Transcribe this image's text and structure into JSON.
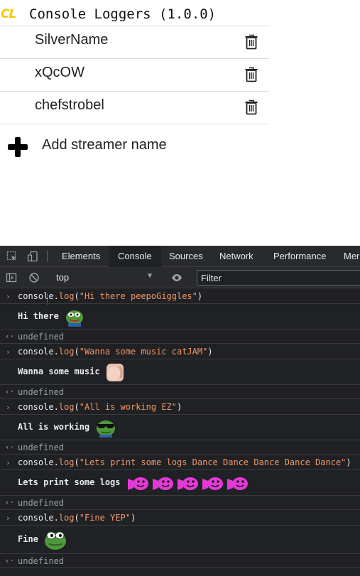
{
  "popup": {
    "logo": "CL",
    "title": "Console Loggers (1.0.0)",
    "streamers": [
      {
        "name": "SilverName"
      },
      {
        "name": "xQcOW"
      },
      {
        "name": "chefstrobel"
      }
    ],
    "add_label": "Add streamer name"
  },
  "devtools": {
    "tabs": [
      "Elements",
      "Console",
      "Sources",
      "Network",
      "Performance",
      "Mer"
    ],
    "active_tab": "Console",
    "context": "top",
    "filter_placeholder": "Filter",
    "entries": [
      {
        "cmd_prefix": "console.",
        "cmd_method": "log",
        "cmd_open": "(",
        "cmd_string": "\"Hi there peepoGiggles\"",
        "cmd_close": ")",
        "output": "Hi there",
        "result": "undefined",
        "emote": "peepoGiggles"
      },
      {
        "cmd_prefix": "console.",
        "cmd_method": "log",
        "cmd_open": "(",
        "cmd_string": "\"Wanna some music catJAM\"",
        "cmd_close": ")",
        "output": "Wanna some music",
        "result": "undefined",
        "emote": "catJAM"
      },
      {
        "cmd_prefix": "console.",
        "cmd_method": "log",
        "cmd_open": "(",
        "cmd_string": "\"All is working EZ\"",
        "cmd_close": ")",
        "output": "All is working",
        "result": "undefined",
        "emote": "EZ"
      },
      {
        "cmd_prefix": "console.",
        "cmd_method": "log",
        "cmd_open": "(",
        "cmd_string": "\"Lets print some logs Dance Dance Dance Dance Dance\"",
        "cmd_close": ")",
        "output": "Lets print some logs",
        "result": "undefined",
        "emote": "Dance"
      },
      {
        "cmd_prefix": "console.",
        "cmd_method": "log",
        "cmd_open": "(",
        "cmd_string": "\"Fine YEP\"",
        "cmd_close": ")",
        "output": "Fine",
        "result": "undefined",
        "emote": "YEP"
      }
    ]
  },
  "colors": {
    "logo": "#f7c800",
    "string": "#f29766",
    "console_bg": "#202124",
    "toolbar_bg": "#292a2d",
    "dance_pink": "#e33ad6"
  }
}
